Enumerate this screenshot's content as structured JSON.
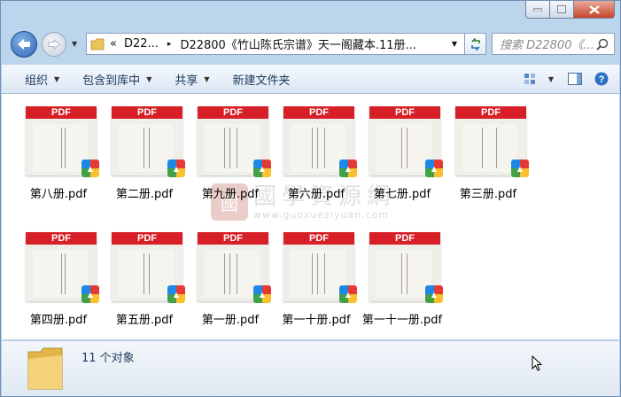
{
  "window": {
    "buttons": {
      "minimize": "–",
      "maximize": "□",
      "close": "✕"
    }
  },
  "nav": {
    "back_icon": "back-arrow-icon",
    "forward_icon": "forward-arrow-icon"
  },
  "address": {
    "overflow": "«",
    "crumb1": "D22...",
    "sep": "▸",
    "crumb2": "D22800《竹山陈氏宗谱》天一阁藏本.11册..."
  },
  "search": {
    "placeholder": "搜索 D22800《..."
  },
  "toolbar": {
    "organize": "组织",
    "include": "包含到库中",
    "share": "共享",
    "new_folder": "新建文件夹"
  },
  "files": [
    {
      "name": "第八册.pdf",
      "band": "PDF"
    },
    {
      "name": "第二册.pdf",
      "band": "PDF"
    },
    {
      "name": "第九册.pdf",
      "band": "PDF"
    },
    {
      "name": "第六册.pdf",
      "band": "PDF"
    },
    {
      "name": "第七册.pdf",
      "band": "PDF"
    },
    {
      "name": "第三册.pdf",
      "band": "PDF"
    },
    {
      "name": "第四册.pdf",
      "band": "PDF"
    },
    {
      "name": "第五册.pdf",
      "band": "PDF"
    },
    {
      "name": "第一册.pdf",
      "band": "PDF"
    },
    {
      "name": "第一十册.pdf",
      "band": "PDF"
    },
    {
      "name": "第一十一册.pdf",
      "band": "PDF"
    }
  ],
  "watermark": {
    "seal": "國",
    "text": "國學資源網",
    "url": "www.guoxueziyuan.com"
  },
  "status": {
    "count": "11 个对象"
  },
  "colors": {
    "pdf_band": "#d61f26",
    "frame": "#bcd4ec",
    "toolbar_text": "#1e395b"
  }
}
